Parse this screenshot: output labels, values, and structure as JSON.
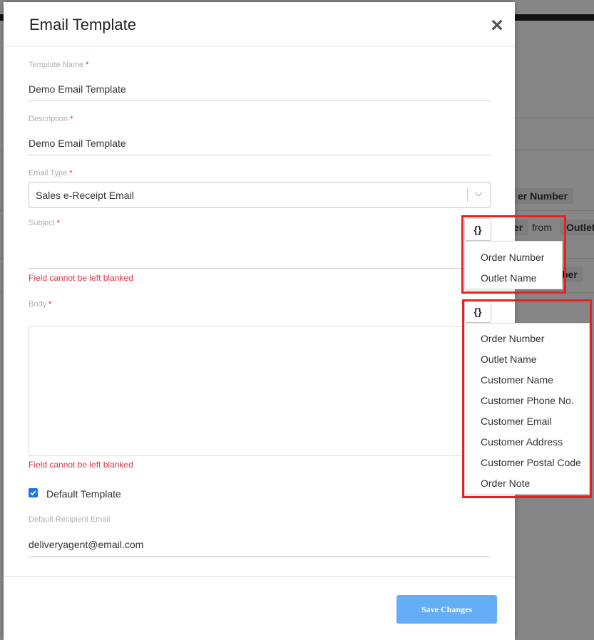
{
  "modal": {
    "title": "Email Template",
    "close_glyph": "×",
    "fields": {
      "template_name": {
        "label": "Template Name",
        "required_mark": "*",
        "value": "Demo Email Template"
      },
      "description": {
        "label": "Description",
        "required_mark": "*",
        "value": "Demo Email Template"
      },
      "email_type": {
        "label": "Email Type",
        "required_mark": "*",
        "value": "Sales e-Receipt Email"
      },
      "subject": {
        "label": "Subject",
        "required_mark": "*",
        "value": "",
        "error": "Field cannot be left blanked"
      },
      "body": {
        "label": "Body",
        "required_mark": "*",
        "value": "",
        "error": "Field cannot be left blanked"
      },
      "default_template": {
        "label": "Default Template",
        "checked": true
      },
      "default_recipient_email": {
        "label": "Default Recipient Email",
        "value": "deliveryagent@email.com"
      }
    },
    "save_label": "Save Changes"
  },
  "subject_variables": {
    "button_label": "{}",
    "items": [
      "Order Number",
      "Outlet Name"
    ]
  },
  "body_variables": {
    "button_label": "{}",
    "items": [
      "Order Number",
      "Outlet Name",
      "Customer Name",
      "Customer Phone No.",
      "Customer Email",
      "Customer Address",
      "Customer Postal Code",
      "Order Note"
    ]
  },
  "background": {
    "chip_order_number_1": "er Number",
    "chip_order_1": "er",
    "text_from": "from",
    "chip_outlet": "Outlet",
    "chip_order_number_2": "ber"
  },
  "colors": {
    "primary_button": "#64aef7",
    "error": "#dc3545",
    "highlight": "#e52222",
    "checkbox": "#1a73e8"
  }
}
